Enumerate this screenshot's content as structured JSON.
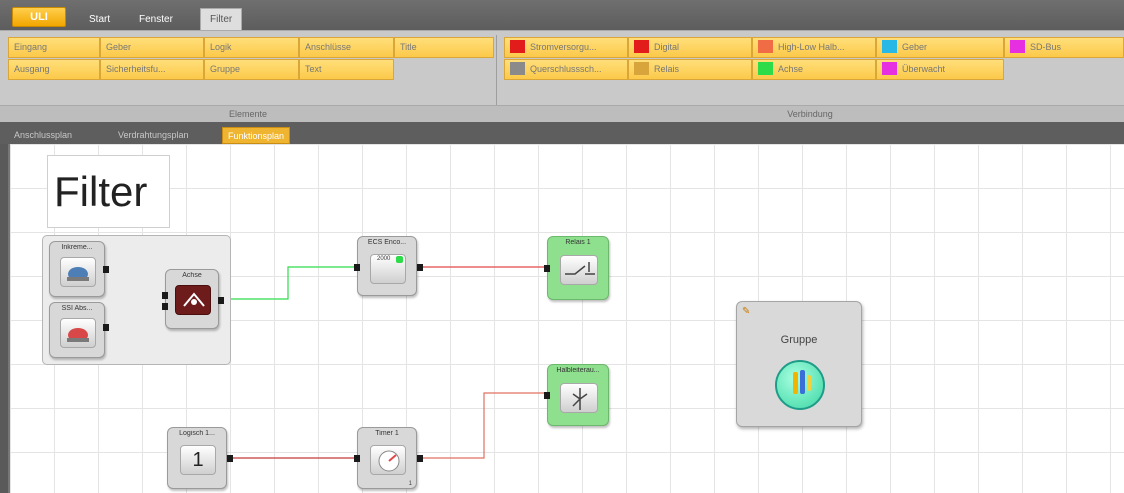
{
  "window": {
    "app_button": "ULI",
    "tabs": [
      {
        "label": "Start"
      },
      {
        "label": "Fenster"
      },
      {
        "label": "Filter"
      }
    ]
  },
  "ribbon": {
    "elemente": {
      "row1": [
        "Eingang",
        "Geber",
        "Logik",
        "Anschlüsse",
        "Title"
      ],
      "row2": [
        "Ausgang",
        "Sicherheitsfu...",
        "Gruppe",
        "Text"
      ],
      "group_label": "Elemente"
    },
    "verbindung": {
      "row1": [
        {
          "label": "Stromversorgu...",
          "color": "#e21b1b"
        },
        {
          "label": "Digital",
          "color": "#e21b1b"
        },
        {
          "label": "High-Low Halb...",
          "color": "#f06c45"
        },
        {
          "label": "Geber",
          "color": "#27b8e6"
        },
        {
          "label": "SD-Bus",
          "color": "#e52fe0"
        }
      ],
      "row2": [
        {
          "label": "Querschlusssch...",
          "color": "#8a8a8a"
        },
        {
          "label": "Relais",
          "color": "#d8a53d"
        },
        {
          "label": "Achse",
          "color": "#2edc4a"
        },
        {
          "label": "Überwacht",
          "color": "#e52fe0"
        }
      ],
      "group_label": "Verbindung"
    }
  },
  "plan_tabs": [
    {
      "label": "Anschlussplan"
    },
    {
      "label": "Verdrahtungsplan"
    },
    {
      "label": "Funktionsplan"
    }
  ],
  "canvas": {
    "title": "Filter",
    "nodes": {
      "inkremental": "Inkreme...",
      "ssi": "SSI Abs...",
      "achse": "Achse",
      "ecs": "ECS Enco...",
      "ecs_badge": "2000",
      "relais": "Relais 1",
      "halbleiter": "Halbleiterau...",
      "logisch": "Logisch 1...",
      "logisch_value": "1",
      "timer": "Timer 1",
      "timer_sub": "1"
    },
    "gruppe": {
      "label": "Gruppe"
    }
  }
}
